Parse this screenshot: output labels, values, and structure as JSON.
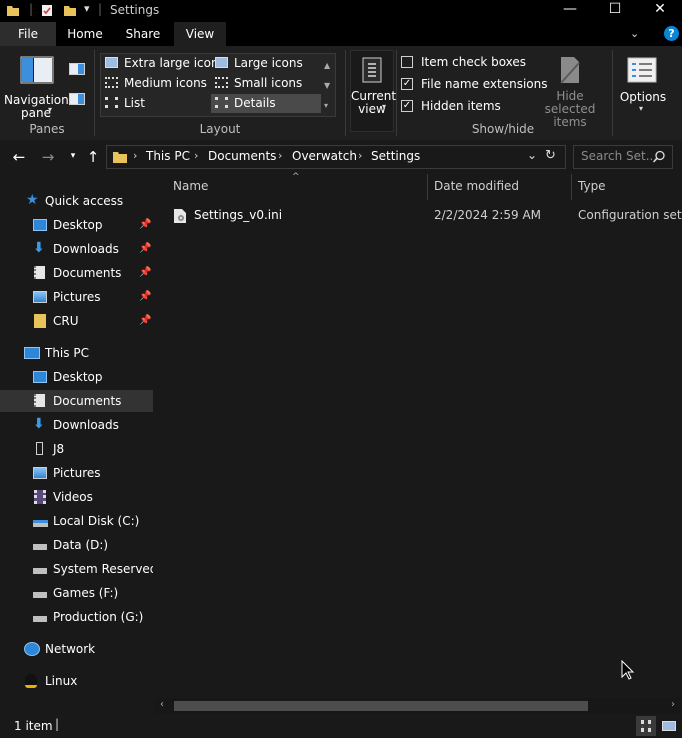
{
  "window": {
    "title": "Settings"
  },
  "tabs": {
    "file": "File",
    "home": "Home",
    "share": "Share",
    "view": "View"
  },
  "ribbon": {
    "panes": {
      "navigation_pane": "Navigation\npane",
      "group_label": "Panes"
    },
    "layout": {
      "items": [
        "Extra large icons",
        "Large icons",
        "Medium icons",
        "Small icons",
        "List",
        "Details"
      ],
      "selected": "Details",
      "group_label": "Layout"
    },
    "current_view": {
      "label": "Current\nview"
    },
    "show_hide": {
      "item_check_boxes": "Item check boxes",
      "file_name_extensions": "File name extensions",
      "hidden_items": "Hidden items",
      "hide_selected_items": "Hide selected\nitems",
      "group_label": "Show/hide",
      "checked": {
        "item_check_boxes": false,
        "file_name_extensions": true,
        "hidden_items": true
      }
    },
    "options": {
      "label": "Options"
    }
  },
  "address": {
    "crumbs": [
      "This PC",
      "Documents",
      "Overwatch",
      "Settings"
    ],
    "search_placeholder": "Search Set..."
  },
  "nav": {
    "quick_access": "Quick access",
    "quick_items": [
      "Desktop",
      "Downloads",
      "Documents",
      "Pictures",
      "CRU"
    ],
    "this_pc": "This PC",
    "pc_items": [
      "Desktop",
      "Documents",
      "Downloads",
      "J8",
      "Pictures",
      "Videos",
      "Local Disk (C:)",
      "Data (D:)",
      "System Reserved (E:)",
      "Games (F:)",
      "Production  (G:)"
    ],
    "selected": "Documents",
    "network": "Network",
    "linux": "Linux"
  },
  "columns": {
    "name": "Name",
    "date_modified": "Date modified",
    "type": "Type"
  },
  "files": [
    {
      "name": "Settings_v0.ini",
      "date_modified": "2/2/2024 2:59 AM",
      "type": "Configuration sett..."
    }
  ],
  "status": {
    "item_count": "1 item"
  },
  "colors": {
    "accent": "#0a84d6",
    "folder": "#e8c25a",
    "selection": "#333333"
  }
}
